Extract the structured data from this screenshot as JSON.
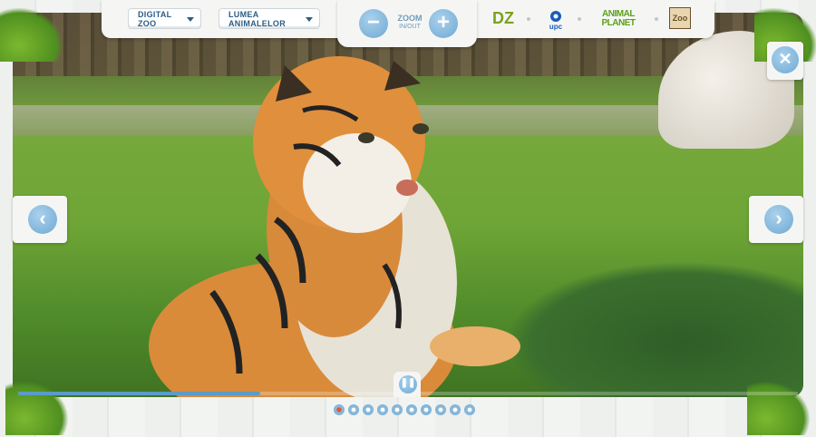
{
  "header": {
    "dropdown_left": "DIGITAL ZOO",
    "dropdown_right": "LUMEA ANIMALELOR",
    "zoom_label": "ZOOM",
    "zoom_sub": "IN/OUT",
    "zoom_out_symbol": "−",
    "zoom_in_symbol": "+",
    "logos": [
      {
        "text": "DZ",
        "color": "#7aa21e"
      },
      {
        "text": "upc",
        "color": "#1a5bb8"
      },
      {
        "text": "ANIMAL PLANET",
        "color": "#5e9f19"
      },
      {
        "text": "Zoo",
        "color": "#6b4f2a"
      }
    ]
  },
  "nav": {
    "prev_symbol": "‹",
    "next_symbol": "›",
    "close_symbol": "✕"
  },
  "player": {
    "pause_symbol": "❚❚",
    "progress": 0.31,
    "slide_count": 10,
    "active_slide": 1
  },
  "colors": {
    "accent": "#6fa9d3",
    "text_blue": "#2d5c84",
    "active_dot": "#e05a3b"
  }
}
